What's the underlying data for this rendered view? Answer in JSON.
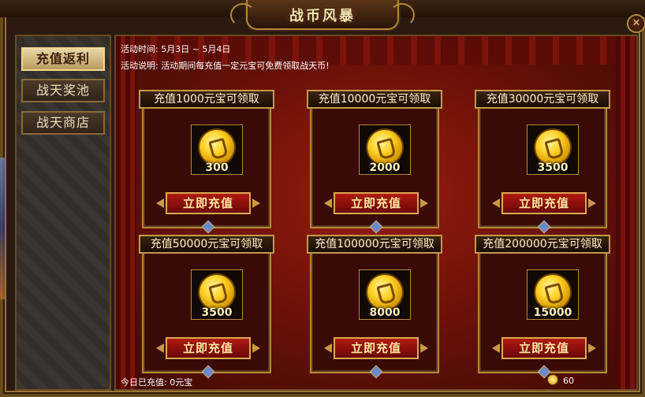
{
  "title": "战币风暴",
  "close_icon": "close-icon",
  "sidebar": {
    "items": [
      {
        "label": "充值返利",
        "active": true
      },
      {
        "label": "战天奖池",
        "active": false
      },
      {
        "label": "战天商店",
        "active": false
      }
    ]
  },
  "info": {
    "time_label": "活动时间:",
    "time_value": "5月3日 ~ 5月4日",
    "desc_label": "活动说明:",
    "desc_value": "活动期间每充值一定元宝可免费领取战天币!"
  },
  "cards": [
    {
      "title": "充值1000元宝可领取",
      "amount": "300",
      "button": "立即充值"
    },
    {
      "title": "充值10000元宝可领取",
      "amount": "2000",
      "button": "立即充值"
    },
    {
      "title": "充值30000元宝可领取",
      "amount": "3500",
      "button": "立即充值"
    },
    {
      "title": "充值50000元宝可领取",
      "amount": "3500",
      "button": "立即充值"
    },
    {
      "title": "充值100000元宝可领取",
      "amount": "8000",
      "button": "立即充值"
    },
    {
      "title": "充值200000元宝可领取",
      "amount": "15000",
      "button": "立即充值"
    }
  ],
  "footer": {
    "recharged_label": "今日已充值:",
    "recharged_value": "0元宝",
    "coin_count": "60",
    "coin_icon": "coin-icon"
  },
  "colors": {
    "accent_gold": "#b48a3a",
    "button_red": "#b01a10",
    "background_red": "#9a1c10"
  }
}
